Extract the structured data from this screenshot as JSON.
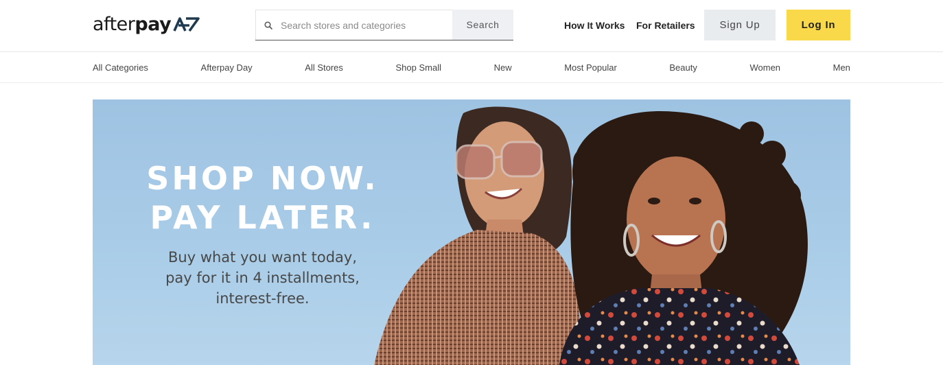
{
  "brand": {
    "wordmark_regular": "after",
    "wordmark_bold": "pay",
    "icon": "afterpay-arrows-icon"
  },
  "search": {
    "placeholder": "Search stores and categories",
    "value": "",
    "button_label": "Search",
    "icon": "search-icon"
  },
  "header_links": {
    "how_it_works": "How It Works",
    "for_retailers": "For Retailers"
  },
  "auth": {
    "sign_up_label": "Sign Up",
    "log_in_label": "Log In"
  },
  "categories": [
    "All Categories",
    "Afterpay Day",
    "All Stores",
    "Shop Small",
    "New",
    "Most Popular",
    "Beauty",
    "Women",
    "Men"
  ],
  "hero": {
    "headline_line1": "SHOP NOW.",
    "headline_line2": "PAY LATER.",
    "sub_line1": "Buy what you want today,",
    "sub_line2": "pay for it in 4 installments,",
    "sub_line3": "interest-free."
  },
  "colors": {
    "accent_yellow": "#f9d949",
    "sign_up_bg": "#e9ecef",
    "hero_sky": "#a9cce8",
    "text_dark": "#222222"
  }
}
